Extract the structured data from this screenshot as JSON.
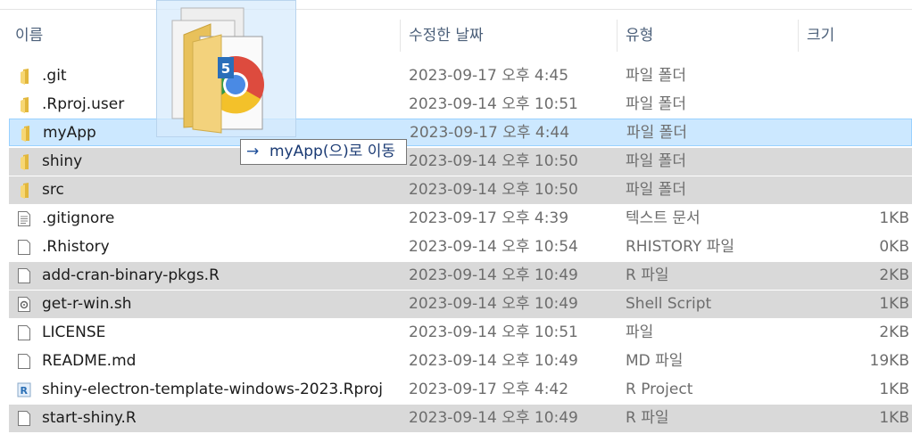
{
  "columns": {
    "name": "이름",
    "date": "수정한 날짜",
    "type": "유형",
    "size": "크기"
  },
  "rows": [
    {
      "name": ".git",
      "date": "2023-09-17 오후 4:45",
      "type": "파일 폴더",
      "size": "",
      "icon": "folder-icon"
    },
    {
      "name": ".Rproj.user",
      "date": "2023-09-14 오후 10:51",
      "type": "파일 폴더",
      "size": "",
      "icon": "folder-icon"
    },
    {
      "name": "myApp",
      "date": "2023-09-17 오후 4:44",
      "type": "파일 폴더",
      "size": "",
      "icon": "folder-icon"
    },
    {
      "name": "shiny",
      "date": "2023-09-14 오후 10:50",
      "type": "파일 폴더",
      "size": "",
      "icon": "folder-icon"
    },
    {
      "name": "src",
      "date": "2023-09-14 오후 10:50",
      "type": "파일 폴더",
      "size": "",
      "icon": "folder-icon"
    },
    {
      "name": ".gitignore",
      "date": "2023-09-17 오후 4:39",
      "type": "텍스트 문서",
      "size": "1KB",
      "icon": "text-file-icon"
    },
    {
      "name": ".Rhistory",
      "date": "2023-09-14 오후 10:54",
      "type": "RHISTORY 파일",
      "size": "0KB",
      "icon": "file-icon"
    },
    {
      "name": "add-cran-binary-pkgs.R",
      "date": "2023-09-14 오후 10:49",
      "type": "R 파일",
      "size": "2KB",
      "icon": "file-icon"
    },
    {
      "name": "get-r-win.sh",
      "date": "2023-09-14 오후 10:49",
      "type": "Shell Script",
      "size": "1KB",
      "icon": "shell-script-icon"
    },
    {
      "name": "LICENSE",
      "date": "2023-09-14 오후 10:51",
      "type": "파일",
      "size": "2KB",
      "icon": "file-icon"
    },
    {
      "name": "README.md",
      "date": "2023-09-14 오후 10:49",
      "type": "MD 파일",
      "size": "19KB",
      "icon": "file-icon"
    },
    {
      "name": "shiny-electron-template-windows-2023.Rproj",
      "date": "2023-09-17 오후 4:42",
      "type": "R Project",
      "size": "1KB",
      "icon": "r-project-icon"
    },
    {
      "name": "start-shiny.R",
      "date": "2023-09-14 오후 10:49",
      "type": "R 파일",
      "size": "1KB",
      "icon": "file-icon"
    }
  ],
  "drag": {
    "count": "5",
    "tooltip_arrow": "→",
    "tooltip": "myApp(으)로 이동"
  }
}
